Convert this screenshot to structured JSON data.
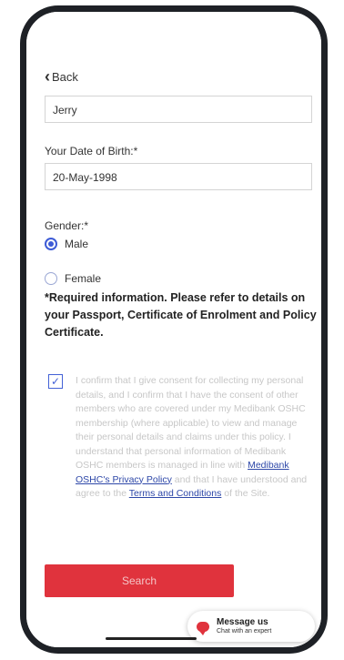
{
  "nav": {
    "back_label": "Back"
  },
  "form": {
    "name_value": "Jerry",
    "dob_label": "Your Date of Birth:*",
    "dob_value": "20-May-1998",
    "gender_label": "Gender:*",
    "gender_options": [
      {
        "label": "Male",
        "selected": true
      },
      {
        "label": "Female",
        "selected": false
      }
    ]
  },
  "required_info": "*Required information. Please refer to details on your Passport, Certificate of Enrolment and Policy Certificate.",
  "consent": {
    "checked": true,
    "text_1": "I confirm that I give consent for collecting my personal details, and I confirm that I have the consent of other members who are covered under my Medibank OSHC membership (where applicable) to view and manage their personal details and claims under this policy. I understand that personal information of Medibank OSHC members is managed in line with",
    "link_privacy": "Medibank OSHC's Privacy Policy",
    "text_2": "and that I have understood and agree to the",
    "link_terms": "Terms and Conditions",
    "text_3": "of the Site."
  },
  "search_label": "Search",
  "chat": {
    "title": "Message us",
    "subtitle": "Chat with an expert"
  },
  "colors": {
    "accent_red": "#e0333d",
    "radio_blue": "#3d5bd6",
    "link_blue": "#2d47a8"
  }
}
